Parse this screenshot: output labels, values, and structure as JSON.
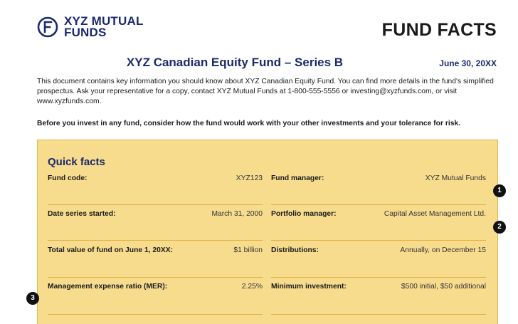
{
  "header": {
    "logo_line1": "XYZ MUTUAL",
    "logo_line2": "FUNDS",
    "doc_title": "FUND FACTS"
  },
  "fund": {
    "title": "XYZ Canadian Equity Fund – Series B",
    "date": "June 30, 20XX"
  },
  "intro": "This document contains key information you should know about XYZ Canadian Equity Fund. You can find more details in the fund's simplified prospectus. Ask your representative for a copy, contact XYZ Mutual Funds at 1-800-555-5556 or investing@xyzfunds.com, or visit www.xyzfunds.com.",
  "lead": "Before you invest in any fund, consider how the fund would work with your other investments and your tolerance for risk.",
  "quick_facts": {
    "title": "Quick facts",
    "left": [
      {
        "label": "Fund code:",
        "value": "XYZ123"
      },
      {
        "label": "Date series started:",
        "value": "March 31, 2000"
      },
      {
        "label": "Total value of fund on June 1, 20XX:",
        "value": "$1 billion"
      },
      {
        "label": "Management expense ratio (MER):",
        "value": "2.25%"
      }
    ],
    "right": [
      {
        "label": "Fund manager:",
        "value": "XYZ Mutual Funds"
      },
      {
        "label": "Portfolio manager:",
        "value": "Capital Asset Management Ltd."
      },
      {
        "label": "Distributions:",
        "value": "Annually, on December 15"
      },
      {
        "label": "Minimum investment:",
        "value": "$500 initial, $50 additional"
      }
    ]
  },
  "markers": [
    "1",
    "2",
    "3"
  ],
  "colors": {
    "brand_navy": "#1b2a6b",
    "facts_background": "#f7dc8e",
    "rule": "#e0b13e"
  }
}
